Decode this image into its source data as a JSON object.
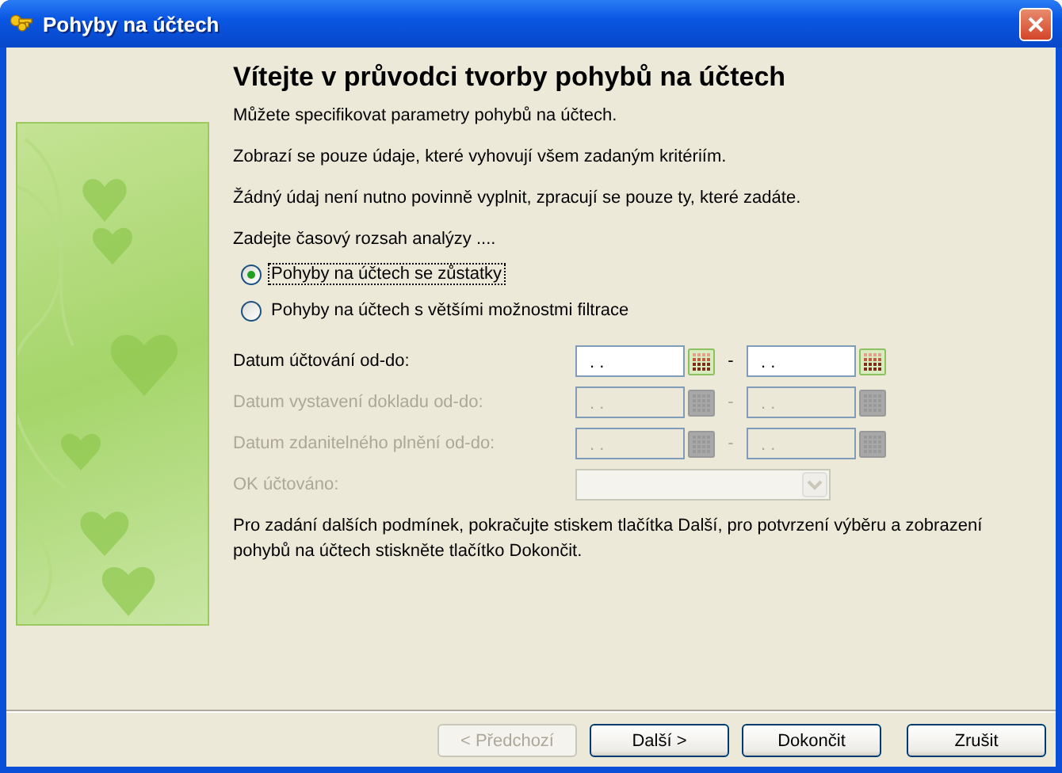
{
  "window": {
    "title": "Pohyby na účtech"
  },
  "heading": "Vítejte v průvodci tvorby pohybů na účtech",
  "intro": [
    "Můžete specifikovat parametry pohybů na účtech.",
    "Zobrazí se pouze údaje, které vyhovují všem zadaným kritériím.",
    "Žádný údaj není nutno povinně vyplnit, zpracují se pouze ty, které zadáte."
  ],
  "range_prompt": "Zadejte časový rozsah analýzy ....",
  "radios": [
    {
      "label": "Pohyby na účtech se zůstatky",
      "selected": true
    },
    {
      "label": "Pohyby na účtech s většími možnostmi filtrace",
      "selected": false
    }
  ],
  "fields": [
    {
      "kind": "date_range",
      "label": "Datum účtování od-do:",
      "from": ". .",
      "separator": "-",
      "to": ". .",
      "disabled": false
    },
    {
      "kind": "date_range",
      "label": "Datum vystavení dokladu od-do:",
      "from": ". .",
      "separator": "-",
      "to": ". .",
      "disabled": true
    },
    {
      "kind": "date_range",
      "label": "Datum zdanitelného plnění od-do:",
      "from": ". .",
      "separator": "-",
      "to": ". .",
      "disabled": true
    },
    {
      "kind": "combo",
      "label": "OK účtováno:",
      "disabled": true
    }
  ],
  "footer_note": "Pro zadání dalších podmínek, pokračujte stiskem tlačítka Další, pro potvrzení výběru a zobrazení pohybů na účtech stiskněte tlačítko Dokončit.",
  "buttons": [
    {
      "label": "< Předchozí",
      "disabled": true
    },
    {
      "label": "Další >",
      "disabled": false
    },
    {
      "label": "Dokončit",
      "disabled": false
    },
    {
      "label": "Zrušit",
      "disabled": false
    }
  ]
}
